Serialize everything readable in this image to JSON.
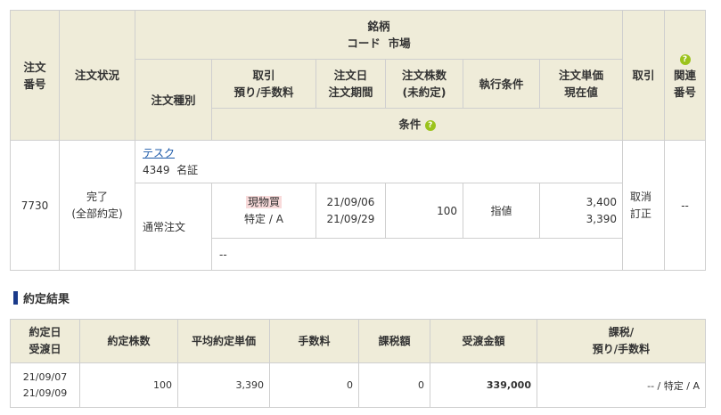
{
  "order_header": {
    "order_number": "注文\n番号",
    "order_status": "注文状況",
    "stock_brand": "銘柄",
    "code_market": "コード  市場",
    "order_type": "注文種別",
    "trade_label": "取引\n預り/手数料",
    "order_date_label": "注文日\n注文期間",
    "quantity_label": "注文株数\n(未約定)",
    "exec_condition_label": "執行条件",
    "unit_price_label": "注文単価\n現在値",
    "cancel_label": "取引",
    "related_number_label": "関連\n番号",
    "condition_label": "条件"
  },
  "order_row": {
    "number": "7730",
    "status": "完了\n(全部約定)",
    "stock_name": "テスク",
    "stock_code_market": "4349  名証",
    "order_type": "通常注文",
    "trade_type": "現物買",
    "account_fee": "特定 / A",
    "order_date": "21/09/06",
    "order_period": "21/09/29",
    "quantity": "100",
    "exec_condition": "指値",
    "order_price": "3,400",
    "current_price": "3,390",
    "cancel_action": "取消",
    "modify_action": "訂正",
    "related_number": "--",
    "condition": "--"
  },
  "exec_section": {
    "title": "約定結果"
  },
  "exec_header": {
    "exec_date": "約定日\n受渡日",
    "exec_quantity": "約定株数",
    "avg_price": "平均約定単価",
    "fee": "手数料",
    "tax": "課税額",
    "settlement": "受渡金額",
    "tax_account": "課税/\n預り/手数料"
  },
  "exec_row": {
    "exec_date": "21/09/07\n21/09/09",
    "exec_quantity": "100",
    "avg_price": "3,390",
    "fee": "0",
    "tax": "0",
    "settlement": "339,000",
    "tax_account": "-- / 特定 / A"
  },
  "icons": {
    "help_icon": "?",
    "help_icon_color": "#9bc31b"
  },
  "colors": {
    "header_bg": "#efecd9",
    "link": "#1a58a8",
    "spot_buy_bg": "#f8dada"
  }
}
